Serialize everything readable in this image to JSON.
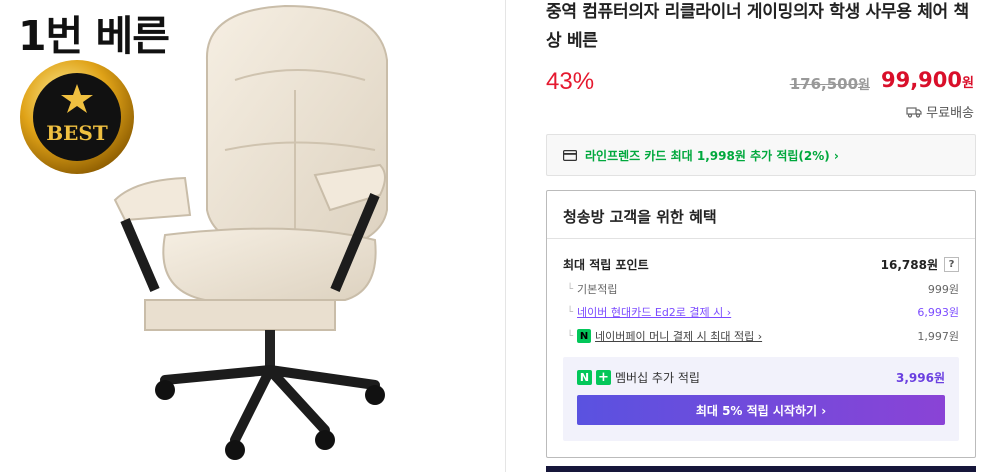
{
  "image": {
    "promo_text": "1번 베른",
    "badge_text": "BEST"
  },
  "product": {
    "title": "중역 컴퓨터의자 리클라이너 게이밍의자 학생 사무용 체어 책상 베른",
    "discount": "43%",
    "original_price": "176,500",
    "original_unit": "원",
    "sale_price": "99,900",
    "sale_unit": "원",
    "shipping": "무료배송"
  },
  "card_promo": {
    "text": "라인프렌즈 카드 최대 1,998원 추가 적립(2%) ›"
  },
  "benefits": {
    "title": "청송방 고객을 위한 혜택",
    "max_points_label": "최대 적립 포인트",
    "max_points_value": "16,788원",
    "help": "?",
    "items": [
      {
        "label": "기본적립",
        "value": "999원",
        "link": false
      },
      {
        "label": "네이버 현대카드 Ed2로 결제 시 ›",
        "value": "6,993원",
        "link": true
      },
      {
        "label": "네이버페이 머니 결제 시 최대 적립 ›",
        "value": "1,997원",
        "link": false
      }
    ],
    "npay_icon": "N",
    "membership": {
      "n_badge": "N",
      "plus_badge": "+",
      "label": "멤버십 추가 적립",
      "value": "3,996원",
      "button": "최대 5% 적립 시작하기 ›"
    }
  },
  "colors": {
    "discount": "#e5192f",
    "sale": "#d90f2a",
    "green": "#00a83d",
    "purple": "#7b4bff"
  }
}
